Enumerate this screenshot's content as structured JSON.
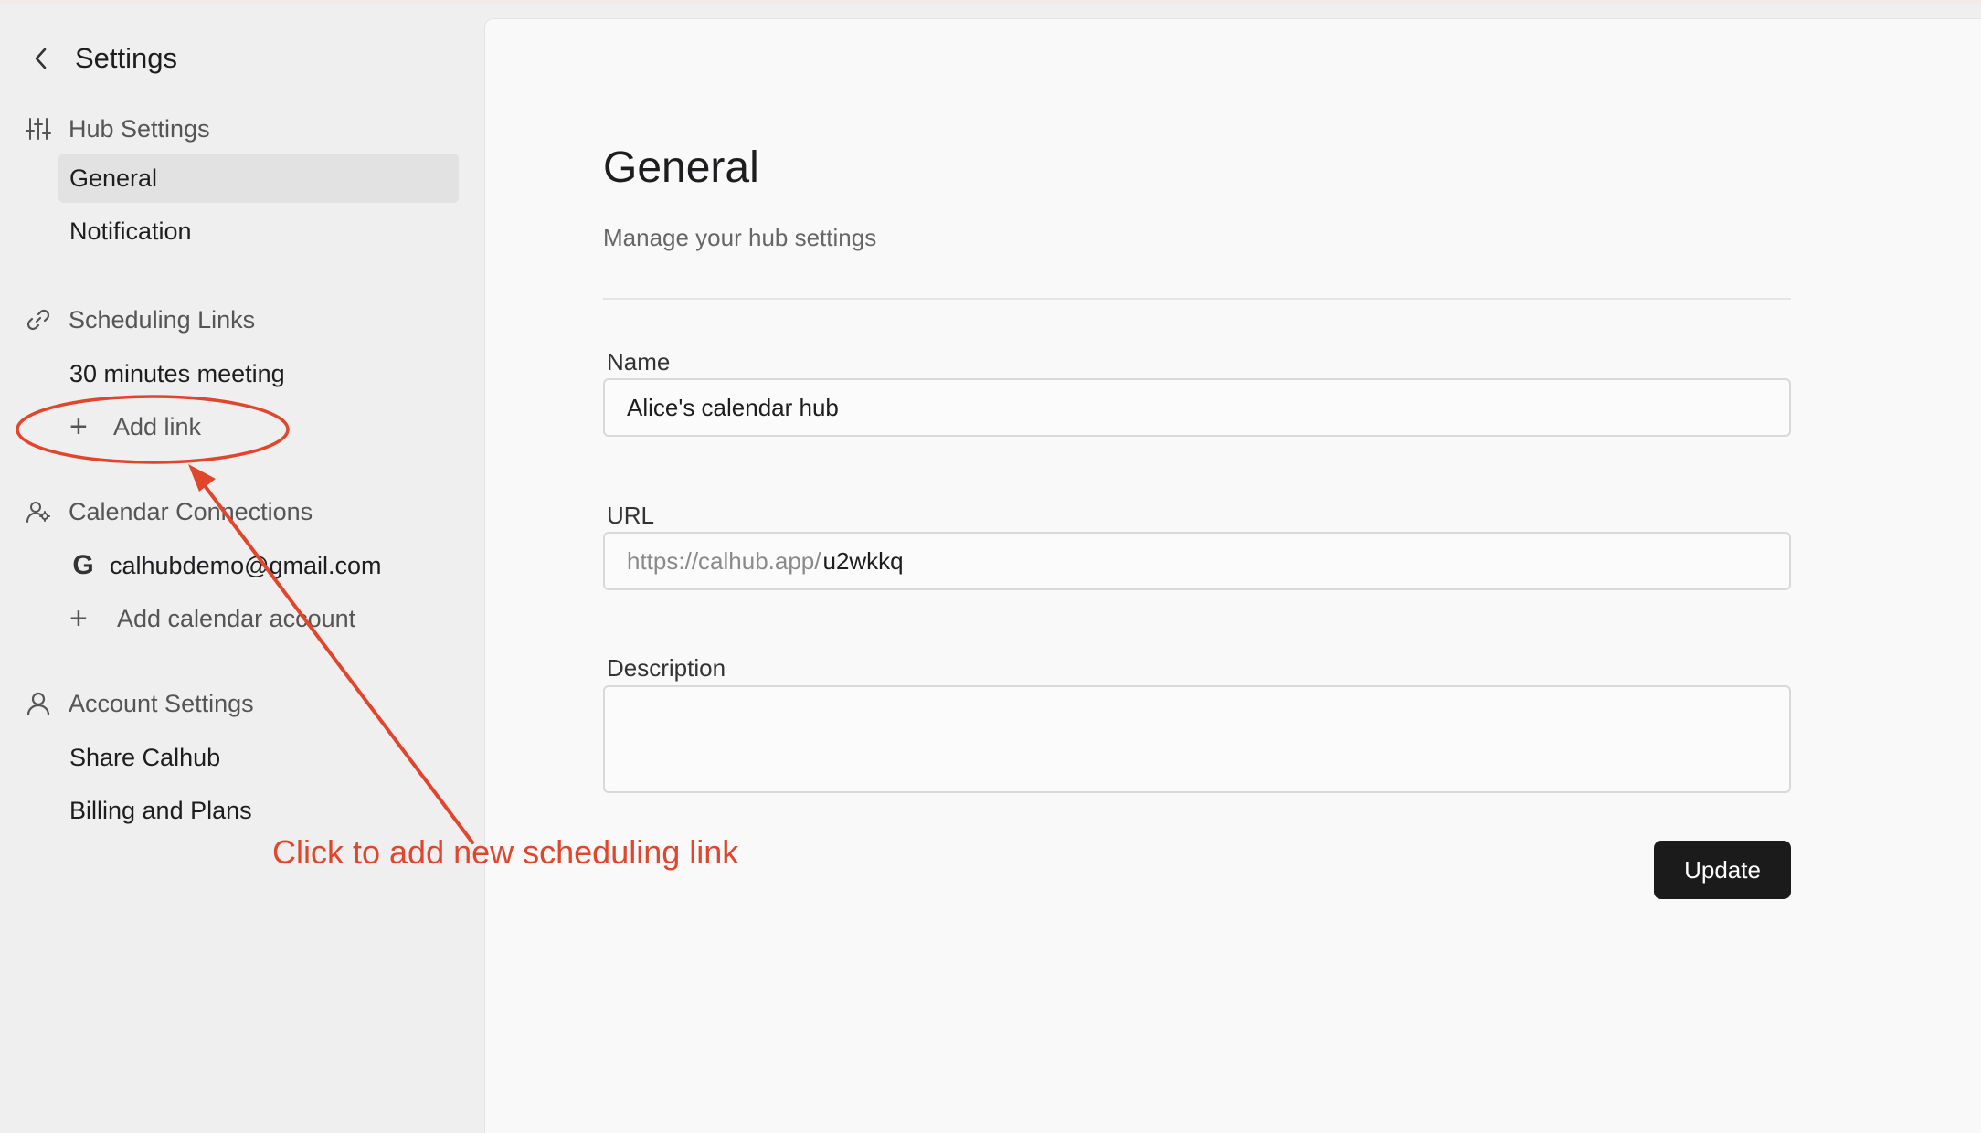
{
  "sidebar": {
    "title": "Settings",
    "sections": [
      {
        "label": "Hub Settings",
        "icon": "sliders-icon",
        "items": [
          "General",
          "Notification"
        ]
      },
      {
        "label": "Scheduling Links",
        "icon": "link-icon",
        "items": [
          "30 minutes meeting"
        ],
        "add_label": "Add link"
      },
      {
        "label": "Calendar Connections",
        "icon": "people-icon",
        "items": [
          "calhubdemo@gmail.com"
        ],
        "add_label": "Add calendar account"
      },
      {
        "label": "Account Settings",
        "icon": "user-icon",
        "items": [
          "Share Calhub",
          "Billing and Plans"
        ]
      }
    ]
  },
  "main": {
    "title": "General",
    "subtitle": "Manage your hub settings",
    "name_field": {
      "label": "Name",
      "value": "Alice's calendar hub"
    },
    "url_field": {
      "label": "URL",
      "prefix": "https://calhub.app/",
      "value": "u2wkkq"
    },
    "description_field": {
      "label": "Description",
      "value": ""
    },
    "update_label": "Update"
  },
  "annotation": {
    "text": "Click to add new scheduling link",
    "color": "#e0462b"
  },
  "colors": {
    "sidebar_bg": "#efefef",
    "main_bg": "#f9f9f9",
    "active_item_bg": "#e2e2e2",
    "button_bg": "#1b1b1b"
  }
}
